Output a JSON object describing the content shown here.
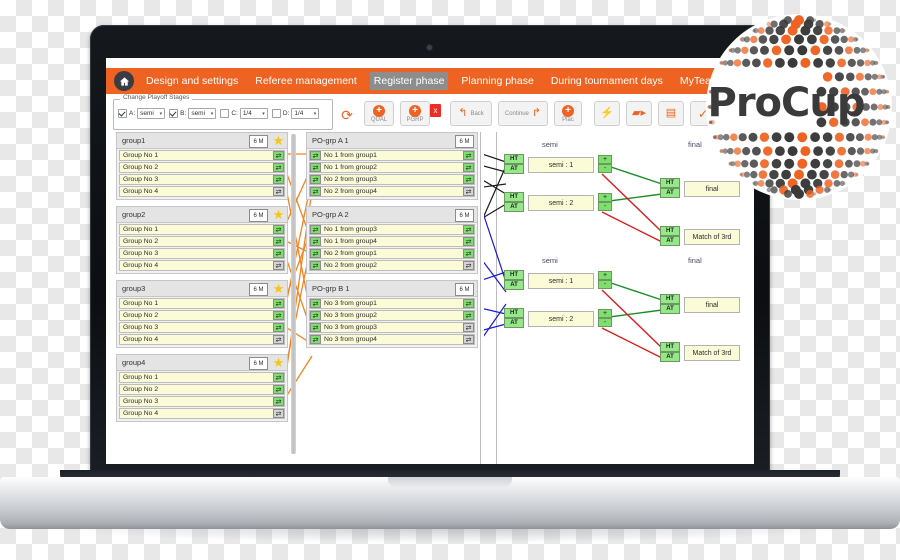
{
  "brand": {
    "name": "ProCup"
  },
  "nav": {
    "home_icon": "home-icon",
    "items": [
      {
        "label": "Design and settings",
        "active": false
      },
      {
        "label": "Referee management",
        "active": false
      },
      {
        "label": "Register phase",
        "active": true
      },
      {
        "label": "Planning phase",
        "active": false
      },
      {
        "label": "During tournament days",
        "active": false
      },
      {
        "label": "MyTeam",
        "active": false
      }
    ]
  },
  "toolbar": {
    "fieldset_legend": "Change Playoff Stages",
    "stages": [
      {
        "label": "A:",
        "checked": true,
        "value": "semi"
      },
      {
        "label": "B:",
        "checked": true,
        "value": "semi"
      },
      {
        "label": "C:",
        "checked": false,
        "value": "1/4"
      },
      {
        "label": "D:",
        "checked": false,
        "value": "1/4"
      }
    ],
    "refresh_icon": "refresh-icon",
    "buttons": [
      {
        "name": "qual-button",
        "label": "QUAL",
        "icon": "plus-circle-icon"
      },
      {
        "name": "pgrp-button",
        "label": "PGRP",
        "icon": "plus-circle-icon"
      },
      {
        "name": "delete-button",
        "label": "x",
        "icon": "close-icon"
      },
      {
        "name": "back-button",
        "label": "Back",
        "icon": "arrow-back-icon"
      },
      {
        "name": "continue-button",
        "label": "Continue",
        "icon": "arrow-forward-icon"
      },
      {
        "name": "plac-button",
        "label": "Plac",
        "icon": "plus-circle-icon"
      },
      {
        "name": "quick-action-button",
        "label": "",
        "icon": "lightning-icon"
      },
      {
        "name": "video-button",
        "label": "",
        "icon": "video-camera-icon"
      },
      {
        "name": "save-button",
        "label": "",
        "icon": "floppy-disk-icon"
      },
      {
        "name": "confirm-button",
        "label": "",
        "icon": "checkmark-icon"
      },
      {
        "name": "help-button",
        "label": "",
        "icon": "question-mark-icon"
      }
    ]
  },
  "groups": [
    {
      "title": "group1",
      "badge": "6 M",
      "rows": [
        {
          "label": "Group No 1",
          "handle": "green"
        },
        {
          "label": "Group No 2",
          "handle": "green"
        },
        {
          "label": "Group No 3",
          "handle": "green"
        },
        {
          "label": "Group No 4",
          "handle": "gray"
        }
      ]
    },
    {
      "title": "group2",
      "badge": "6 M",
      "rows": [
        {
          "label": "Group No 1",
          "handle": "green"
        },
        {
          "label": "Group No 2",
          "handle": "green"
        },
        {
          "label": "Group No 3",
          "handle": "green"
        },
        {
          "label": "Group No 4",
          "handle": "gray"
        }
      ]
    },
    {
      "title": "group3",
      "badge": "6 M",
      "rows": [
        {
          "label": "Group No 1",
          "handle": "green"
        },
        {
          "label": "Group No 2",
          "handle": "green"
        },
        {
          "label": "Group No 3",
          "handle": "green"
        },
        {
          "label": "Group No 4",
          "handle": "gray"
        }
      ]
    },
    {
      "title": "group4",
      "badge": "6 M",
      "rows": [
        {
          "label": "Group No 1",
          "handle": "green"
        },
        {
          "label": "Group No 2",
          "handle": "green"
        },
        {
          "label": "Group No 3",
          "handle": "green"
        },
        {
          "label": "Group No 4",
          "handle": "gray"
        }
      ]
    }
  ],
  "playoff_groups": [
    {
      "title": "PO-grp A 1",
      "badge": "6 M",
      "rows": [
        {
          "label": "No 1 from group1",
          "handle_left": "green",
          "handle_right": "green"
        },
        {
          "label": "No 1 from group2",
          "handle_left": "green",
          "handle_right": "green"
        },
        {
          "label": "No 2 from group3",
          "handle_left": "green",
          "handle_right": "green"
        },
        {
          "label": "No 2 from group4",
          "handle_left": "green",
          "handle_right": "gray"
        }
      ]
    },
    {
      "title": "PO-grp A 2",
      "badge": "6 M",
      "rows": [
        {
          "label": "No 1 from group3",
          "handle_left": "green",
          "handle_right": "green"
        },
        {
          "label": "No 1 from group4",
          "handle_left": "green",
          "handle_right": "green"
        },
        {
          "label": "No 2 from group1",
          "handle_left": "green",
          "handle_right": "green"
        },
        {
          "label": "No 2 from group2",
          "handle_left": "green",
          "handle_right": "gray"
        }
      ]
    },
    {
      "title": "PO-grp B 1",
      "badge": "6 M",
      "rows": [
        {
          "label": "No 3 from group1",
          "handle_left": "green",
          "handle_right": "green"
        },
        {
          "label": "No 3 from group2",
          "handle_left": "green",
          "handle_right": "green"
        },
        {
          "label": "No 3 from group3",
          "handle_left": "green",
          "handle_right": "gray"
        },
        {
          "label": "No 3 from group4",
          "handle_left": "green",
          "handle_right": "gray"
        }
      ]
    }
  ],
  "bracket": {
    "stage_labels": {
      "semi": "semi",
      "final": "final"
    },
    "home_abbr": "HT",
    "away_abbr": "AT",
    "plus": "+",
    "minus": "-",
    "upper": {
      "semi_1": "semi : 1",
      "semi_2": "semi : 2",
      "final": "final",
      "third": "Match of 3rd"
    },
    "lower": {
      "semi_1": "semi : 1",
      "semi_2": "semi : 2",
      "final": "final",
      "third": "Match of 3rd"
    }
  },
  "colors": {
    "accent_orange": "#ef6322",
    "row_yellow": "#fbfbd8",
    "handle_green": "#7ede6e",
    "star_gold": "#f5c518",
    "link_black": "#1a1a1a",
    "link_blue": "#1a1ad8",
    "link_green": "#1e8c28",
    "link_red": "#d81f1f",
    "connector_orange": "#f58220"
  }
}
